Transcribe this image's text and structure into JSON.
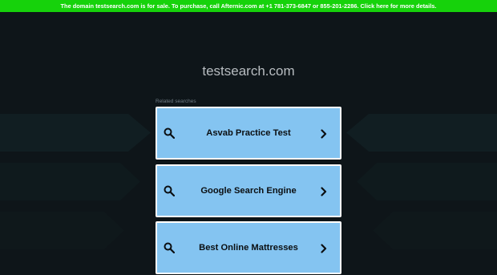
{
  "banner": {
    "text": "The domain testsearch.com is for sale. To purchase, call Afternic.com at +1 781-373-6847 or 855-201-2286. Click here for more details."
  },
  "domain": "testsearch.com",
  "related_label": "Related searches",
  "results": [
    {
      "label": "Asvab Practice Test",
      "icon": "search-icon",
      "arrow": "chevron-right-icon"
    },
    {
      "label": "Google Search Engine",
      "icon": "search-icon",
      "arrow": "chevron-right-icon"
    },
    {
      "label": "Best Online Mattresses",
      "icon": "search-icon",
      "arrow": "chevron-right-icon"
    }
  ],
  "colors": {
    "banner_bg": "#16d20b",
    "page_bg": "#0e1519",
    "result_bg": "#84c4f1",
    "result_border": "#ffffff"
  }
}
